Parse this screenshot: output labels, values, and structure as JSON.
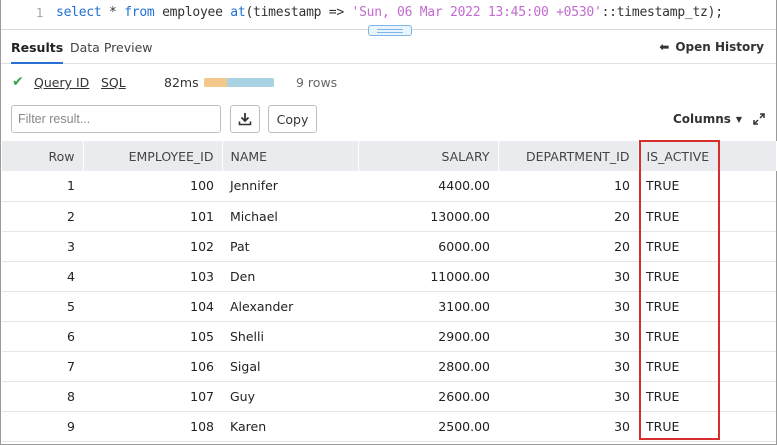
{
  "editor": {
    "line_number": "1",
    "code": {
      "kw_select": "select",
      "star": " * ",
      "kw_from": "from",
      "table": " employee ",
      "kw_at": "at",
      "mid": "(timestamp => ",
      "literal": "'Sun, 06 Mar 2022 13:45:00 +0530'",
      "tail": "::timestamp_tz);"
    }
  },
  "tabs": {
    "results": "Results",
    "data_preview": "Data Preview",
    "open_history": "Open History"
  },
  "status": {
    "query_id": "Query ID",
    "sql": "SQL",
    "duration": "82ms",
    "rows": "9 rows",
    "timing_fraction": 0.33
  },
  "toolbar": {
    "filter_placeholder": "Filter result...",
    "copy": "Copy",
    "columns": "Columns"
  },
  "table": {
    "headers": [
      "Row",
      "EMPLOYEE_ID",
      "NAME",
      "SALARY",
      "DEPARTMENT_ID",
      "IS_ACTIVE"
    ],
    "rows": [
      [
        "1",
        "100",
        "Jennifer",
        "4400.00",
        "10",
        "TRUE"
      ],
      [
        "2",
        "101",
        "Michael",
        "13000.00",
        "20",
        "TRUE"
      ],
      [
        "3",
        "102",
        "Pat",
        "6000.00",
        "20",
        "TRUE"
      ],
      [
        "4",
        "103",
        "Den",
        "11000.00",
        "30",
        "TRUE"
      ],
      [
        "5",
        "104",
        "Alexander",
        "3100.00",
        "30",
        "TRUE"
      ],
      [
        "6",
        "105",
        "Shelli",
        "2900.00",
        "30",
        "TRUE"
      ],
      [
        "7",
        "106",
        "Sigal",
        "2800.00",
        "30",
        "TRUE"
      ],
      [
        "8",
        "107",
        "Guy",
        "2600.00",
        "30",
        "TRUE"
      ],
      [
        "9",
        "108",
        "Karen",
        "2500.00",
        "30",
        "TRUE"
      ]
    ]
  },
  "colors": {
    "accent": "#2a6fd3",
    "success": "#3aa34b",
    "highlight": "#d62d2d",
    "header_bg": "#e9ebee"
  },
  "icons": {
    "status": "check-icon",
    "history": "arrow-left-icon",
    "download": "download-icon",
    "columns": "caret-down-icon",
    "expand": "expand-icon"
  }
}
